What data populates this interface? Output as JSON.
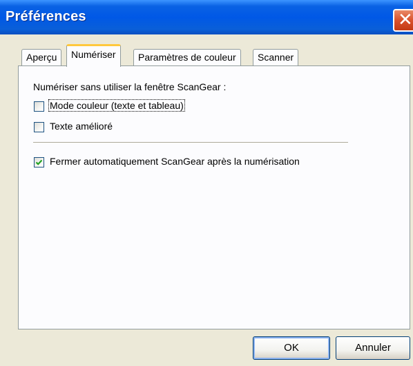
{
  "window": {
    "title": "Préférences",
    "close_glyph": "✕"
  },
  "tabs": [
    {
      "label": "Aperçu",
      "active": false
    },
    {
      "label": "Numériser",
      "active": true
    },
    {
      "label": "Paramètres de couleur",
      "active": false
    },
    {
      "label": "Scanner",
      "active": false
    }
  ],
  "panel": {
    "heading": "Numériser sans utiliser la fenêtre ScanGear :",
    "options": [
      {
        "label": "Mode couleur (texte et tableau)",
        "checked": false
      },
      {
        "label": "Texte amélioré",
        "checked": false
      }
    ],
    "auto_close": {
      "label": "Fermer automatiquement ScanGear après la numérisation",
      "checked": true
    }
  },
  "buttons": {
    "ok": "OK",
    "cancel": "Annuler"
  },
  "colors": {
    "titlebar": "#0058e6",
    "check": "#21a121",
    "active_tab_accent": "#ffc83c"
  }
}
